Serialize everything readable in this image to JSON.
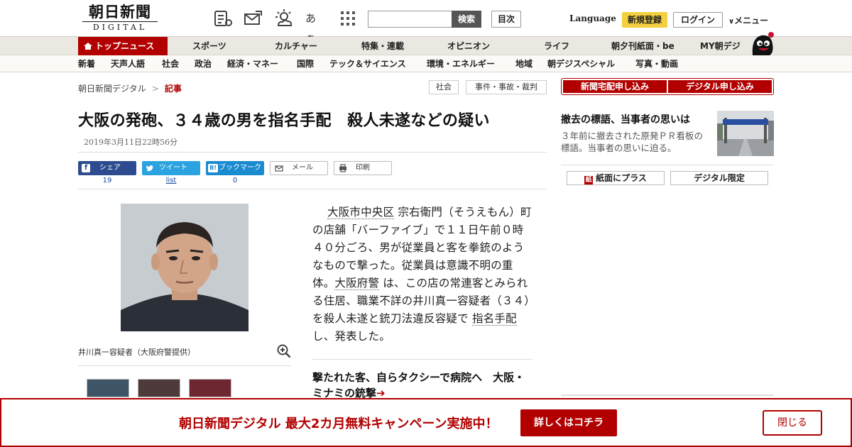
{
  "header": {
    "logo_main": "朝日新聞",
    "logo_sub": "DIGITAL",
    "icons": [
      "news-reader-icon",
      "mail-icon",
      "weather-icon",
      "font-size-icon",
      "grid-menu-icon"
    ],
    "font_size_glyph": "あぁ",
    "search_placeholder": "",
    "search_button": "検索",
    "index_button": "目次",
    "language": "Language",
    "register": "新規登録",
    "login": "ログイン",
    "menu": "メニュー"
  },
  "nav_primary": {
    "active": "トップニュース",
    "items": [
      "スポーツ",
      "カルチャー",
      "特集・連載",
      "オピニオン",
      "ライフ",
      "朝夕刊紙面・be",
      "MY朝デジ"
    ]
  },
  "nav_secondary": {
    "items": [
      "新着",
      "天声人語",
      "社会",
      "政治",
      "経済・マネー",
      "国際",
      "テック＆サイエンス",
      "環境・エネルギー",
      "地域",
      "朝デジスペシャル",
      "写真・動画"
    ]
  },
  "breadcrumb": {
    "home": "朝日新聞デジタル",
    "separator": ">",
    "current": "記事"
  },
  "tags": [
    "社会",
    "事件・事故・裁判"
  ],
  "article": {
    "headline": "大阪の発砲、３４歳の男を指名手配　殺人未遂などの疑い",
    "timestamp": "2019年3月11日22時56分",
    "photo_caption": "井川真一容疑者（大阪府警提供）",
    "body": {
      "kw1": "大阪市中央区",
      "t1": " 宗右衛門（そうえもん）町の店舗「バーファイブ」で１１日午前０時４０分ごろ、男が従業員と客を拳銃のようなもので撃った。従業員は意識不明の重体。",
      "kw2": "大阪府警",
      "t2": " は、この店の常連客とみられる住居、職業不詳の井川真一容疑者（３４）を殺人未遂と銃刀法違反容疑で ",
      "kw3": "指名手配",
      "t3": " し、発表した。"
    },
    "related": "撃たれた客、自らタクシーで病院へ　大阪・ミナミの銃撃",
    "related_arrow": "➔"
  },
  "share": {
    "facebook": {
      "label": "シェア",
      "count": "19",
      "icon": "f"
    },
    "twitter": {
      "label": "ツイート",
      "count": "list",
      "icon": "t"
    },
    "hatena": {
      "label": "ブックマーク",
      "count": "0",
      "icon": "B!"
    },
    "mail": {
      "label": "メール"
    },
    "print": {
      "label": "印刷"
    },
    "colors": {
      "facebook": "#2d4b8e",
      "twitter": "#2aa3e0",
      "hatena": "#1b8bd0"
    }
  },
  "sidebar": {
    "subscribe_paper": "新聞宅配申し込み",
    "subscribe_digital": "デジタル申し込み",
    "headline": "撤去の標語、当事者の思いは",
    "description": "３年前に撤去された原発ＰＲ看板の標語。当事者の思いに迫る。",
    "button_paper_plus": "紙面にプラス",
    "button_digital_only": "デジタル限定"
  },
  "banner": {
    "text": "朝日新聞デジタル  最大2カ月無料キャンペーン実施中！",
    "cta": "詳しくはコチラ",
    "close": "閉じる"
  },
  "colors": {
    "accent": "#b20000",
    "highlight": "#f4d03f"
  }
}
